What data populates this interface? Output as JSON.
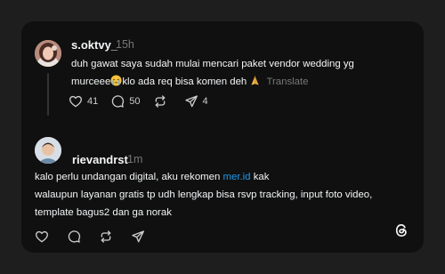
{
  "posts": [
    {
      "username": "s.oktvy_",
      "timestamp": "15h",
      "text_line1": "duh gawat saya sudah mulai mencari paket vendor wedding yg",
      "text_line2_a": "murceee",
      "text_line2_b": "klo ada req bisa komen deh",
      "translate_label": "Translate",
      "emoji_1": "crying-face",
      "emoji_2": "folded-hands",
      "likes": "41",
      "replies": "50",
      "reposts": "",
      "shares": "4"
    },
    {
      "username": "rievandrst",
      "timestamp": "1m",
      "text_line1_a": "kalo perlu undangan digital, aku rekomen ",
      "link_text": "mer.id",
      "text_line1_b": " kak",
      "text_line2": "walaupun layanan gratis tp udh lengkap bisa rsvp tracking, input foto video,",
      "text_line3": "template bagus2 dan ga norak"
    }
  ],
  "colors": {
    "page_background": "#1e1e1e",
    "card_background": "#101010",
    "primary_text": "#f3f5f7",
    "secondary_text": "#777777",
    "link": "#1d9bf0"
  },
  "icons": [
    "heart-icon",
    "comment-icon",
    "repost-icon",
    "share-icon",
    "threads-logo-icon"
  ]
}
